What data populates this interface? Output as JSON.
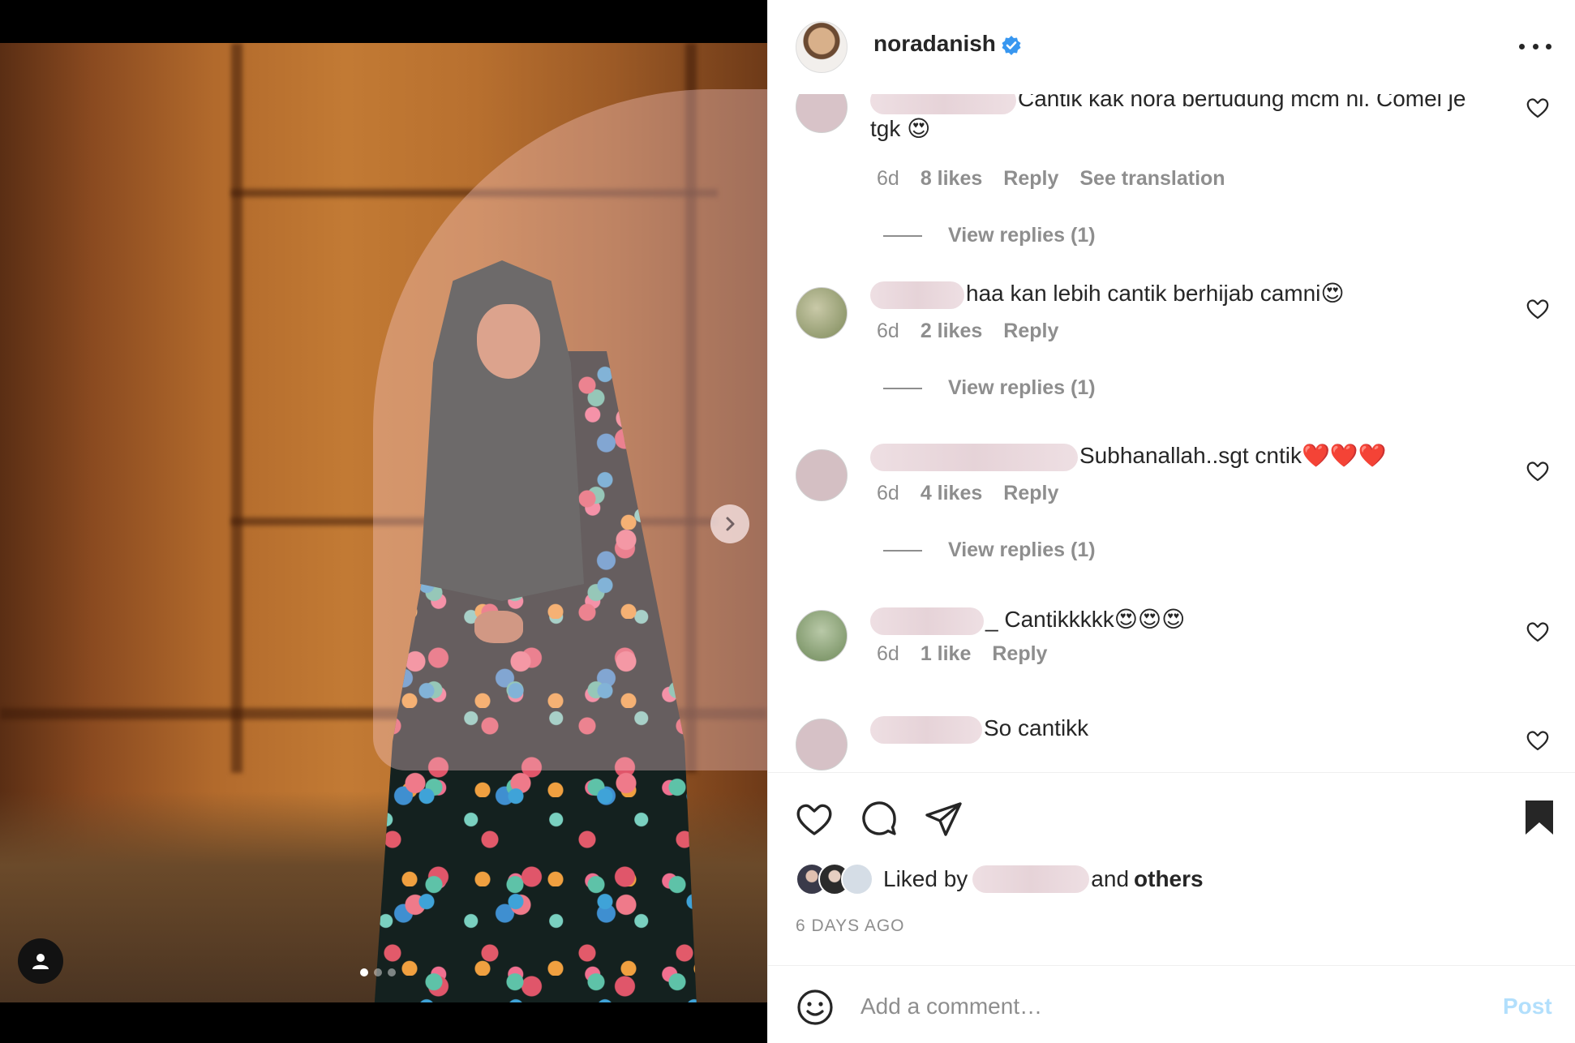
{
  "post": {
    "username": "noradanish",
    "verified_icon": "verified-badge-icon",
    "carousel": {
      "slide_count": 3,
      "active_slide": 1
    }
  },
  "comments": [
    {
      "text": "Cantik kak nora bertudung mcm ni. Comel je tgk 😍",
      "time": "6d",
      "likes": "8 likes",
      "reply": "Reply",
      "translate": "See translation",
      "view_replies": "View replies (1)"
    },
    {
      "text": "haa kan lebih cantik berhijab camni😍",
      "time": "6d",
      "likes": "2 likes",
      "reply": "Reply",
      "view_replies": "View replies (1)"
    },
    {
      "text": "Subhanallah..sgt cntik❤️❤️❤️",
      "time": "6d",
      "likes": "4 likes",
      "reply": "Reply",
      "view_replies": "View replies (1)"
    },
    {
      "text": "_ Cantikkkkk😍😍😍",
      "time": "6d",
      "likes": "1 like",
      "reply": "Reply"
    },
    {
      "text": "So cantikk"
    }
  ],
  "footer": {
    "liked_by_prefix": "Liked by",
    "liked_by_suffix": "and",
    "liked_by_others": "others",
    "time_ago": "6 DAYS AGO",
    "comment_placeholder": "Add a comment…",
    "post_label": "Post"
  },
  "colors": {
    "text": "#262626",
    "secondary": "#8e8e8e",
    "post_disabled": "#b2dffc",
    "verified": "#3897f0"
  }
}
